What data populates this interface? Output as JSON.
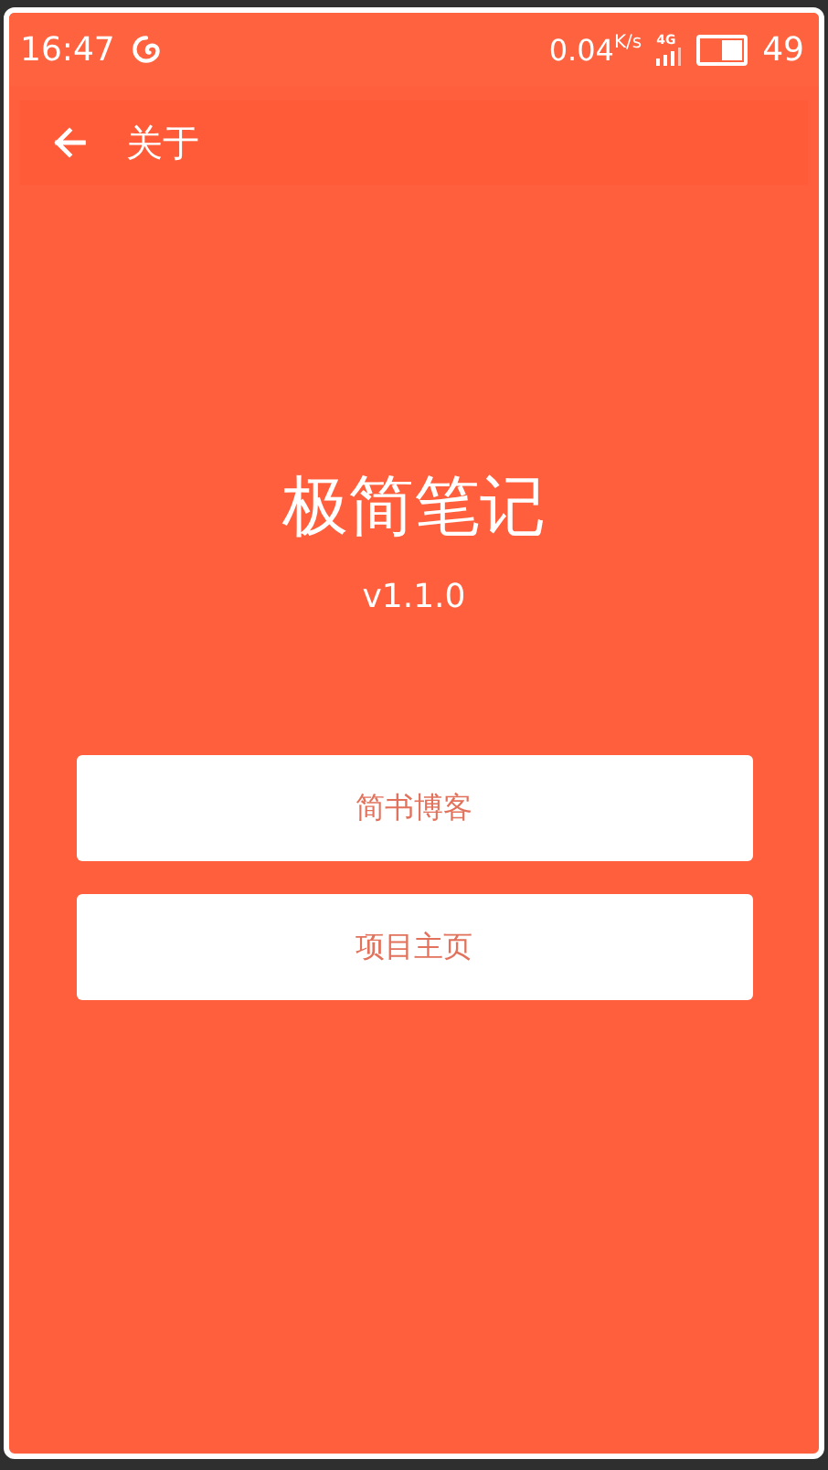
{
  "status_bar": {
    "time": "16:47",
    "net_speed": "0.04",
    "net_unit": "K/s",
    "network_type": "4G",
    "battery": "49"
  },
  "toolbar": {
    "title": "关于"
  },
  "app": {
    "name": "极简笔记",
    "version": "v1.1.0"
  },
  "buttons": [
    {
      "label": "简书博客"
    },
    {
      "label": "项目主页"
    }
  ]
}
